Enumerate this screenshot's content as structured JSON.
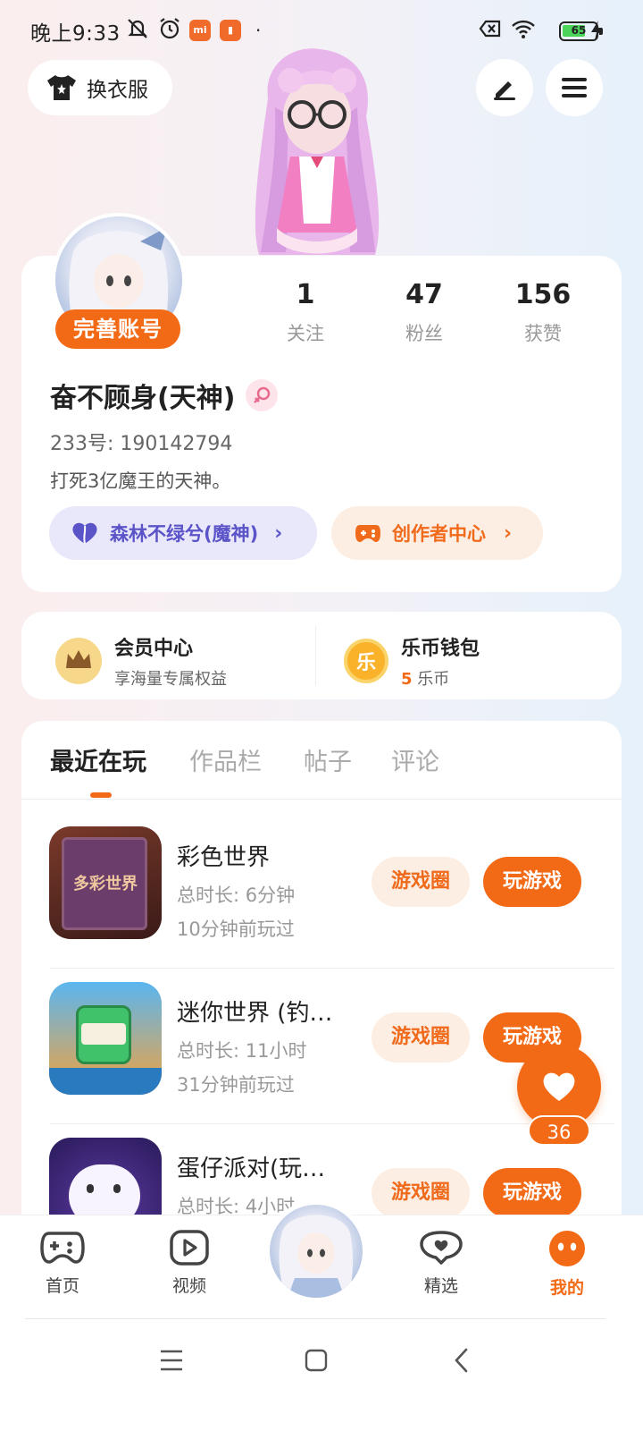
{
  "status": {
    "time": "晚上9:33",
    "battery": "65",
    "app_badge": "mi"
  },
  "header": {
    "outfit_label": "换衣服",
    "edit_icon": "pen-icon",
    "menu_icon": "hamburger-icon"
  },
  "profile": {
    "complete_label": "完善账号",
    "stats": [
      {
        "value": "1",
        "label": "关注"
      },
      {
        "value": "47",
        "label": "粉丝"
      },
      {
        "value": "156",
        "label": "获赞"
      }
    ],
    "name": "奋不顾身(天神)",
    "id": "233号: 190142794",
    "bio": "打死3亿魔王的天神。",
    "chip_partner": "森林不绿兮(魔神)",
    "chip_creator": "创作者中心"
  },
  "vip": {
    "member_title": "会员中心",
    "member_sub": "享海量专属权益",
    "wallet_title": "乐币钱包",
    "wallet_amount": "5",
    "wallet_unit": "乐币",
    "wallet_icon_text": "乐"
  },
  "tabs": [
    "最近在玩",
    "作品栏",
    "帖子",
    "评论"
  ],
  "games": [
    {
      "name": "彩色世界",
      "duration": "总时长: 6分钟",
      "last": "10分钟前玩过",
      "icon_text": "多彩世界"
    },
    {
      "name": "迷你世界 (钓…",
      "duration": "总时长: 11小时",
      "last": "31分钟前玩过"
    },
    {
      "name": "蛋仔派对(玩…",
      "duration": "总时长: 4小时",
      "last": ""
    }
  ],
  "game_buttons": {
    "circle": "游戏圈",
    "play": "玩游戏"
  },
  "like": {
    "count": "36"
  },
  "nav": [
    {
      "label": "首页",
      "icon": "gamepad-icon"
    },
    {
      "label": "视频",
      "icon": "video-play-icon"
    },
    {
      "label": "",
      "icon": "avatar"
    },
    {
      "label": "精选",
      "icon": "heart-bubble-icon"
    },
    {
      "label": "我的",
      "icon": "face-icon"
    }
  ],
  "colors": {
    "accent": "#f36a16",
    "purple": "#5b54c8",
    "chip_orange_bg": "#fdeee3",
    "chip_purple_bg": "#e9e8fb"
  }
}
